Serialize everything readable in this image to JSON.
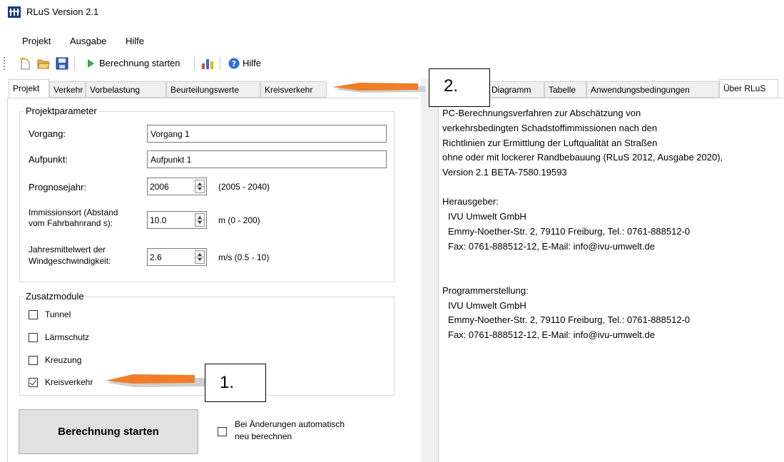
{
  "window": {
    "title": "RLuS Version 2.1"
  },
  "menu": [
    "Projekt",
    "Ausgabe",
    "Hilfe"
  ],
  "toolbar": {
    "run_label": "Berechnung starten",
    "help_label": "Hilfe"
  },
  "left_tabs": [
    "Projekt",
    "Verkehr",
    "Vorbelastung",
    "Beurteilungswerte",
    "Kreisverkehr"
  ],
  "right_tabs": [
    "Diagramm",
    "Tabelle",
    "Anwendungsbedingungen",
    "Über RLuS"
  ],
  "project": {
    "group_label": "Projektparameter",
    "vorgang_label": "Vorgang:",
    "vorgang_value": "Vorgang 1",
    "aufpunkt_label": "Aufpunkt:",
    "aufpunkt_value": "Aufpunkt 1",
    "prognose_label": "Prognosejahr:",
    "prognose_value": "2006",
    "prognose_range": "(2005 - 2040)",
    "immission_label_1": "Immissionsort (Abstand",
    "immission_label_2": "vom Fahrbahnrand s):",
    "immission_value": "10.0",
    "immission_range": "m  (0 - 200)",
    "wind_label_1": "Jahresmittelwert der",
    "wind_label_2": "Windgeschwindigkeit:",
    "wind_value": "2.6",
    "wind_range": "m/s  (0.5 - 10)"
  },
  "modules": {
    "group_label": "Zusatzmodule",
    "items": [
      {
        "label": "Tunnel",
        "checked": false
      },
      {
        "label": "Lärmschutz",
        "checked": false
      },
      {
        "label": "Kreuzung",
        "checked": false
      },
      {
        "label": "Kreisverkehr",
        "checked": true
      }
    ]
  },
  "calc_button": "Berechnung starten",
  "auto_recalc": {
    "line1": "Bei Änderungen automatisch",
    "line2": "neu berechnen",
    "checked": false
  },
  "about": {
    "lines": [
      "PC-Berechnungsverfahren zur Abschätzung von",
      "verkehrsbedingten Schadstoffimmissionen nach den",
      "Richtlinien zur Ermittlung der Luftqualität an Straßen",
      "ohne oder mit lockerer Randbebauung (RLuS 2012, Ausgabe 2020),",
      "Version 2.1 BETA-7580.19593",
      "Herausgeber:",
      "  IVU Umwelt GmbH",
      "  Emmy-Noether-Str. 2, 79110 Freiburg, Tel.: 0761-888512-0",
      "  Fax: 0761-888512-12, E-Mail: info@ivu-umwelt.de",
      "Programmerstellung:",
      "  IVU Umwelt GmbH",
      "  Emmy-Noether-Str. 2, 79110 Freiburg, Tel.: 0761-888512-0",
      "  Fax: 0761-888512-12, E-Mail: info@ivu-umwelt.de"
    ]
  },
  "annotations": {
    "callout_1": "1.",
    "callout_2": "2."
  },
  "colors": {
    "arrow": "#f07d28",
    "tab_bg": "#f0f0f0",
    "button_bg": "#e1e1e1",
    "help_icon": "#2a6fd6"
  },
  "icons": [
    "app-logo-icon",
    "new-file-icon",
    "open-folder-icon",
    "save-disk-icon",
    "play-icon",
    "chart-icon",
    "help-icon"
  ]
}
